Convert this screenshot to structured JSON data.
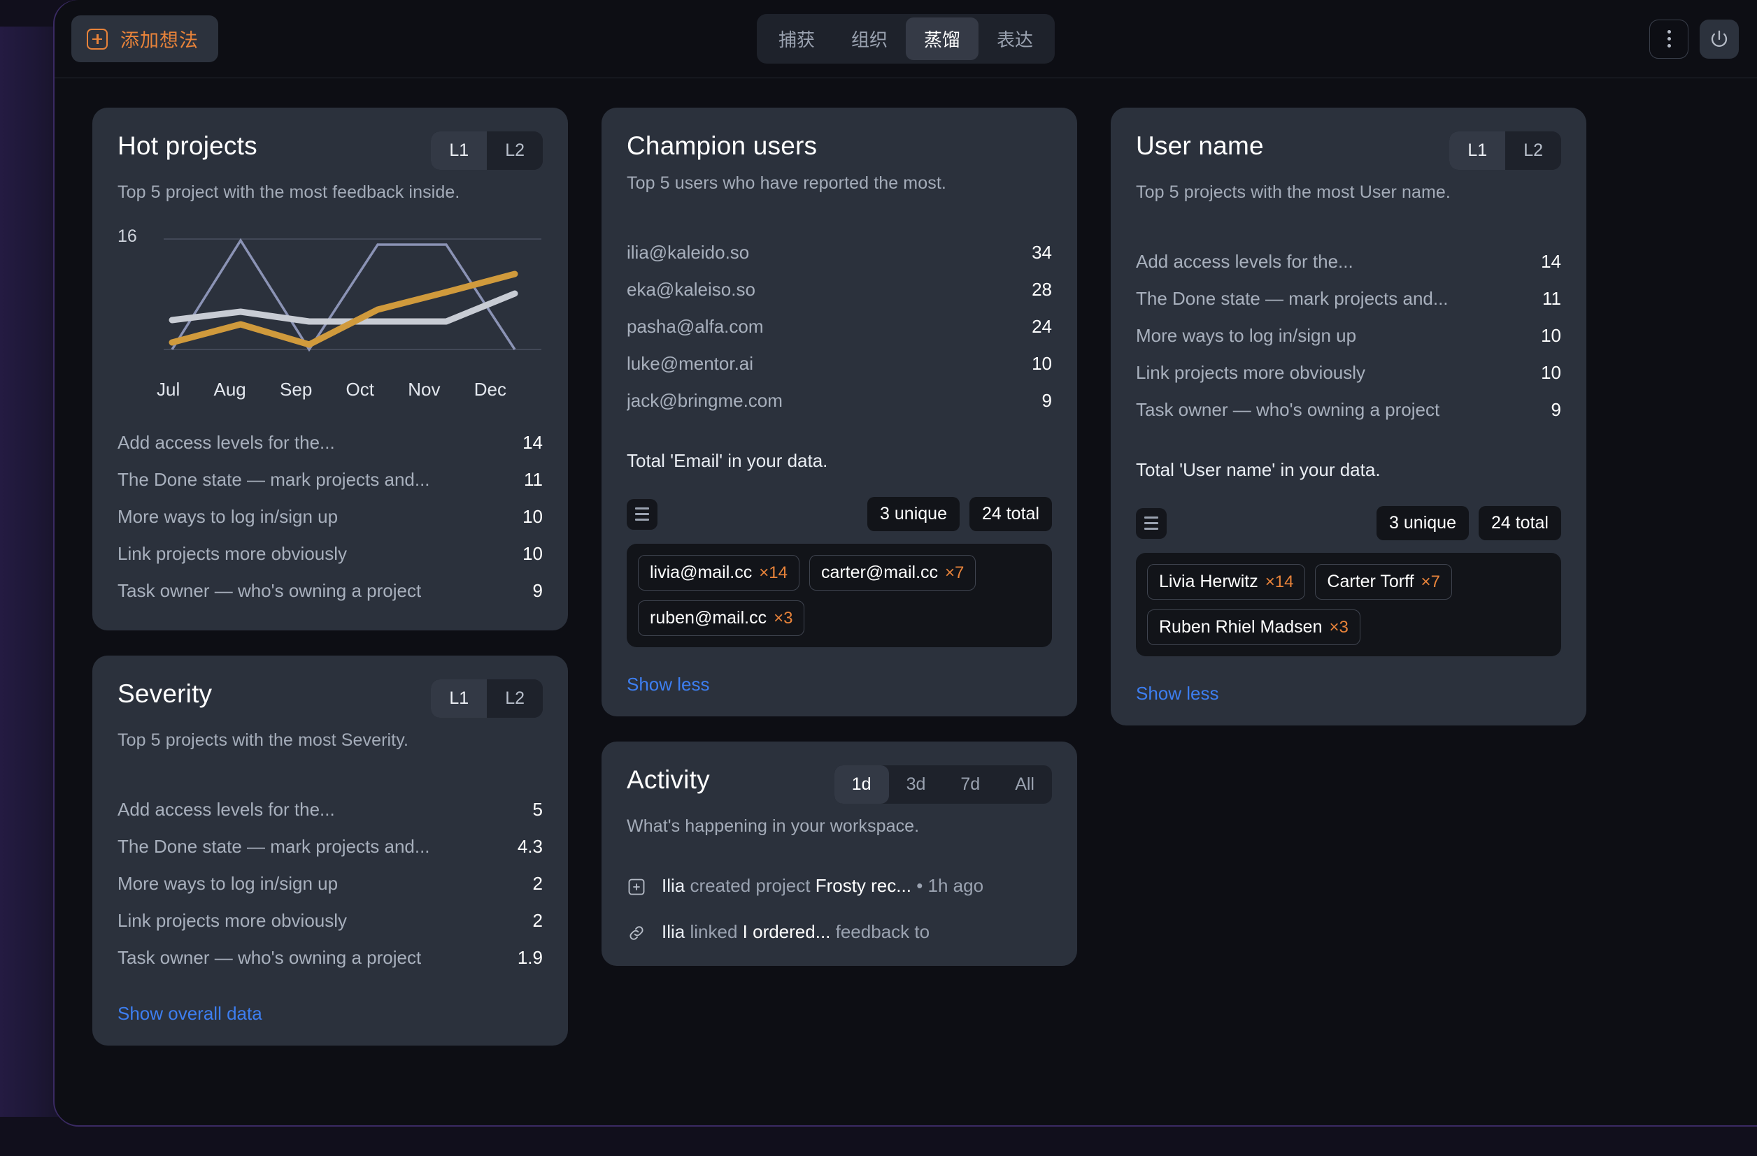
{
  "topbar": {
    "add_button": {
      "label": "添加想法",
      "icon": "plus-square-icon"
    },
    "tabs": [
      {
        "label": "捕获",
        "active": false
      },
      {
        "label": "组织",
        "active": false
      },
      {
        "label": "蒸馏",
        "active": true
      },
      {
        "label": "表达",
        "active": false
      }
    ],
    "more_icon": "three-dots-vertical-icon",
    "power_icon": "power-icon"
  },
  "colors": {
    "accent_orange": "#e8833a",
    "link_blue": "#3d7ef0",
    "card_bg": "#2b313c",
    "chart_line_periwinkle": "#8b93b5",
    "chart_line_gray": "#c8ccd4",
    "chart_line_gold": "#d09a3c"
  },
  "hot_projects": {
    "title": "Hot projects",
    "subtitle": "Top 5 project with the most feedback inside.",
    "level_toggle": {
      "options": [
        "L1",
        "L2"
      ],
      "selected": "L1"
    },
    "rows": [
      {
        "label": "Add access levels for the...",
        "value": "14"
      },
      {
        "label": "The Done state — mark projects and...",
        "value": "11"
      },
      {
        "label": "More ways to log in/sign up",
        "value": "10"
      },
      {
        "label": "Link projects more obviously",
        "value": "10"
      },
      {
        "label": "Task owner — who's owning a project",
        "value": "9"
      }
    ]
  },
  "chart_data": {
    "type": "line",
    "title": "Hot projects",
    "x": [
      "Jul",
      "Aug",
      "Sep",
      "Oct",
      "Nov",
      "Dec"
    ],
    "xlabel": "",
    "ylabel": "",
    "ylim": [
      0,
      16
    ],
    "ymax_label": "16",
    "grid": false,
    "legend": "none",
    "series": [
      {
        "name": "series-periwinkle",
        "color": "#8b93b5",
        "values": [
          0,
          16,
          0,
          15,
          15,
          0
        ]
      },
      {
        "name": "series-gray",
        "color": "#c8ccd4",
        "values": [
          4.2,
          5.4,
          4.4,
          4.4,
          4.4,
          8.0
        ]
      },
      {
        "name": "series-gold",
        "color": "#d09a3c",
        "values": [
          1.0,
          3.6,
          0.8,
          5.8,
          8.2,
          11.0
        ]
      }
    ]
  },
  "severity": {
    "title": "Severity",
    "subtitle": "Top 5 projects with the most Severity.",
    "level_toggle": {
      "options": [
        "L1",
        "L2"
      ],
      "selected": "L1"
    },
    "rows": [
      {
        "label": "Add access levels for the...",
        "value": "5"
      },
      {
        "label": "The Done state — mark projects and...",
        "value": "4.3"
      },
      {
        "label": "More ways to log in/sign up",
        "value": "2"
      },
      {
        "label": "Link projects more obviously",
        "value": "2"
      },
      {
        "label": "Task owner — who's owning a project",
        "value": "1.9"
      }
    ],
    "link_label": "Show overall data"
  },
  "champion_users": {
    "title": "Champion users",
    "subtitle": "Top 5 users who have reported the most.",
    "rows": [
      {
        "label": "ilia@kaleido.so",
        "value": "34"
      },
      {
        "label": "eka@kaleiso.so",
        "value": "28"
      },
      {
        "label": "pasha@alfa.com",
        "value": "24"
      },
      {
        "label": "luke@mentor.ai",
        "value": "10"
      },
      {
        "label": "jack@bringme.com",
        "value": "9"
      }
    ],
    "total_text": "Total 'Email' in your data.",
    "list_icon": "hamburger-icon",
    "unique_badge": "3 unique",
    "total_badge": "24 total",
    "tags": [
      {
        "label": "livia@mail.cc",
        "mult": "×14"
      },
      {
        "label": "carter@mail.cc",
        "mult": "×7"
      },
      {
        "label": "ruben@mail.cc",
        "mult": "×3"
      }
    ],
    "link_label": "Show less"
  },
  "user_name": {
    "title": "User name",
    "subtitle": "Top 5 projects with the most User name.",
    "level_toggle": {
      "options": [
        "L1",
        "L2"
      ],
      "selected": "L1"
    },
    "rows": [
      {
        "label": "Add access levels for the...",
        "value": "14"
      },
      {
        "label": "The Done state — mark projects and...",
        "value": "11"
      },
      {
        "label": "More ways to log in/sign up",
        "value": "10"
      },
      {
        "label": "Link projects more obviously",
        "value": "10"
      },
      {
        "label": "Task owner — who's owning a project",
        "value": "9"
      }
    ],
    "total_text": "Total 'User name' in your data.",
    "list_icon": "hamburger-icon",
    "unique_badge": "3 unique",
    "total_badge": "24 total",
    "tags": [
      {
        "label": "Livia Herwitz",
        "mult": "×14"
      },
      {
        "label": "Carter Torff",
        "mult": "×7"
      },
      {
        "label": "Ruben Rhiel Madsen",
        "mult": "×3"
      }
    ],
    "link_label": "Show less"
  },
  "activity": {
    "title": "Activity",
    "subtitle": "What's happening in your workspace.",
    "ranges": [
      {
        "label": "1d",
        "active": true
      },
      {
        "label": "3d",
        "active": false
      },
      {
        "label": "7d",
        "active": false
      },
      {
        "label": "All",
        "active": false
      }
    ],
    "items": [
      {
        "icon": "plus-square-icon",
        "actor": "Ilia",
        "verb": "created project",
        "object": "Frosty rec...",
        "time": "• 1h ago"
      },
      {
        "icon": "link-icon",
        "actor": "Ilia",
        "verb": "linked",
        "object": "I ordered...",
        "time": "feedback to"
      }
    ]
  }
}
